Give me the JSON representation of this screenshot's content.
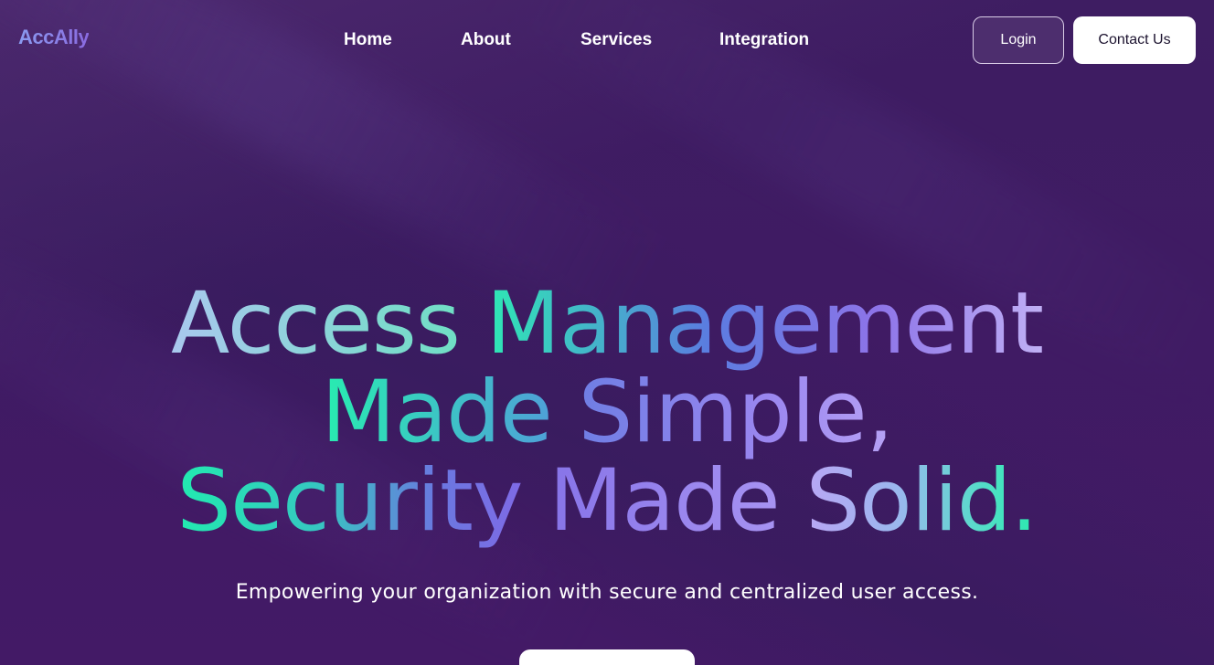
{
  "brand": {
    "logo_text": "AccAlly"
  },
  "nav": {
    "items": [
      {
        "label": "Home"
      },
      {
        "label": "About"
      },
      {
        "label": "Services"
      },
      {
        "label": "Integration"
      }
    ]
  },
  "header_actions": {
    "login_label": "Login",
    "contact_label": "Contact Us"
  },
  "hero": {
    "title_words": {
      "access": "Access",
      "management": "Management",
      "made_1": "Made",
      "simple": "Simple,",
      "security": "Security",
      "made_2": "Made",
      "solid": "Solid."
    },
    "subtitle": "Empowering your organization with secure and centralized user access."
  },
  "colors": {
    "background": "#3e1d62",
    "accent_teal": "#2ee8b4",
    "accent_purple": "#8d74e8",
    "button_white": "#ffffff"
  }
}
